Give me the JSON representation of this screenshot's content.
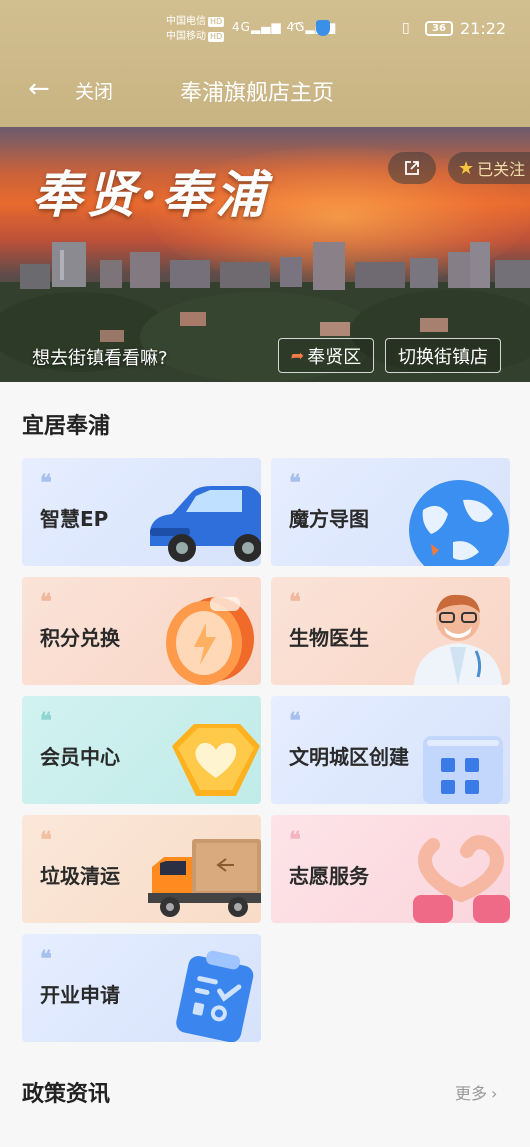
{
  "status_bar": {
    "carrier1": "中国电信",
    "carrier2": "中国移动",
    "hd": "HD",
    "signal": "4G",
    "battery": "36",
    "time": "21:22"
  },
  "header": {
    "close_label": "关闭",
    "title": "奉浦旗舰店主页"
  },
  "banner": {
    "title": "奉贤·奉浦",
    "follow_label": "已关注",
    "prompt": "想去街镇看看嘛?",
    "district_label": "奉贤区",
    "switch_label": "切换街镇店"
  },
  "sections": {
    "livable_title": "宜居奉浦",
    "policy_title": "政策资讯",
    "more_label": "更多"
  },
  "cards": [
    {
      "label": "智慧EP",
      "icon": "car-icon"
    },
    {
      "label": "魔方导图",
      "icon": "globe-icon"
    },
    {
      "label": "积分兑换",
      "icon": "coin-icon"
    },
    {
      "label": "生物医生",
      "icon": "doctor-icon"
    },
    {
      "label": "会员中心",
      "icon": "heart-badge-icon"
    },
    {
      "label": "文明城区创建",
      "icon": "building-icon"
    },
    {
      "label": "垃圾清运",
      "icon": "truck-icon"
    },
    {
      "label": "志愿服务",
      "icon": "heart-hands-icon"
    },
    {
      "label": "开业申请",
      "icon": "clipboard-icon"
    }
  ],
  "colors": {
    "header_bg": "#c8b382",
    "accent_gold": "#f5c542"
  }
}
